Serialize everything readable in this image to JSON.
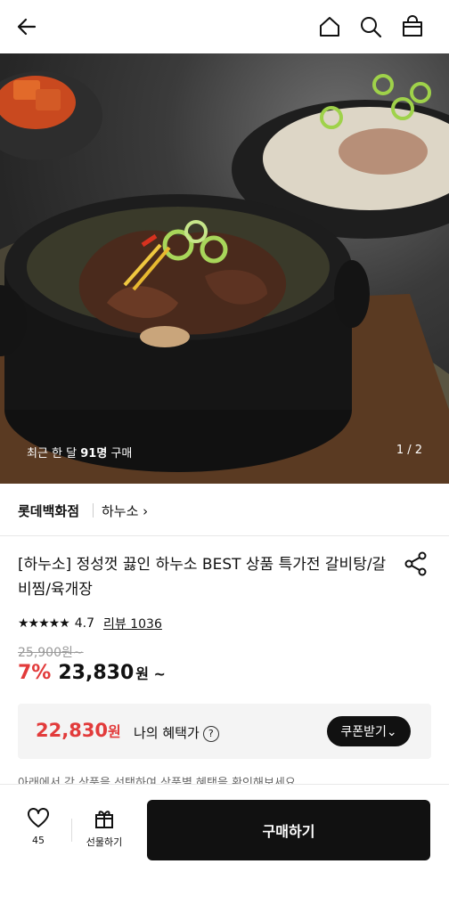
{
  "header": {
    "back_icon": "arrow-left-icon",
    "home_icon": "home-icon",
    "search_icon": "search-icon",
    "cart_icon": "shopping-bag-icon"
  },
  "hero": {
    "purchase_prefix": "최근 한 달 ",
    "purchase_count": "91명",
    "purchase_suffix": " 구매",
    "pager": "1 / 2"
  },
  "brand": {
    "store": "롯데백화점",
    "brand_link": "하누소 ›"
  },
  "product": {
    "title": "[하누소] 정성껏 끓인 하누소 BEST 상품 특가전 갈비탕/갈비찜/육개장",
    "share_icon": "share-icon",
    "stars": "★★★★★",
    "rating": "4.7",
    "review": "리뷰 1036",
    "original_price": "25,900원~",
    "discount": "7%",
    "price": "23,830",
    "price_unit": "원 ~"
  },
  "benefit": {
    "price": "22,830",
    "unit": "원",
    "label": "나의 혜택가",
    "help": "?",
    "coupon": "쿠폰받기⌄"
  },
  "notice": "아래에서 각 상품을 선택하여 상품별 혜택을 확인해보세요",
  "bottom": {
    "like_count": "45",
    "gift_label": "선물하기",
    "buy_label": "구매하기"
  },
  "colors": {
    "accent": "#e23b3b",
    "dark": "#111111"
  }
}
